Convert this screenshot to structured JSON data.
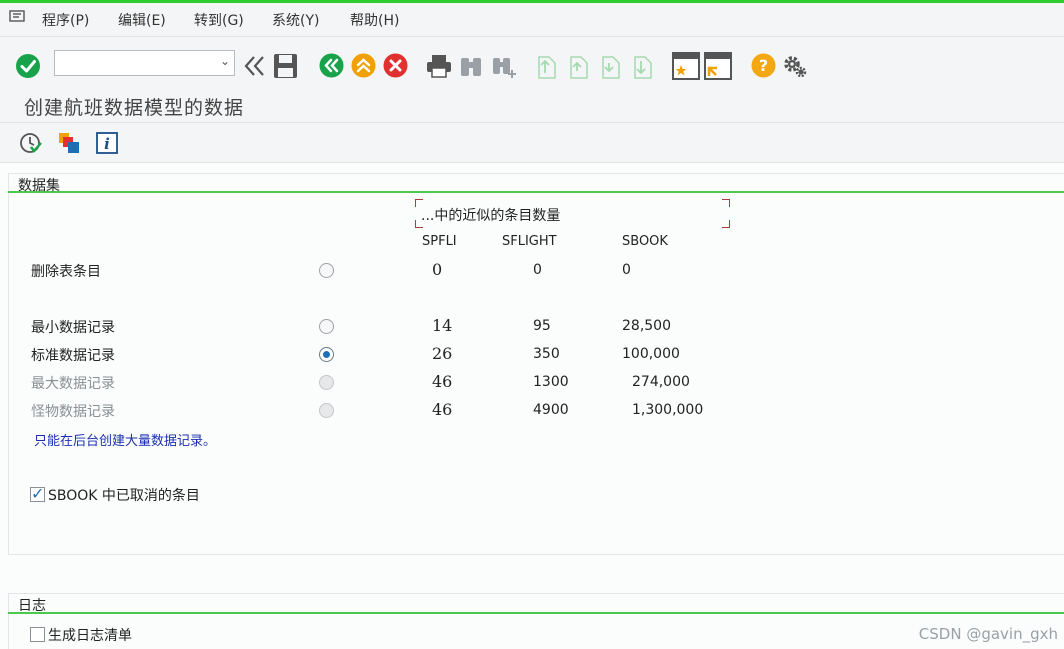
{
  "menubar": {
    "items": [
      "程序(P)",
      "编辑(E)",
      "转到(G)",
      "系统(Y)",
      "帮助(H)"
    ]
  },
  "toolbar": {
    "command_value": "",
    "icons": [
      "enter-icon",
      "command-field",
      "back-double-icon",
      "save-icon",
      "back-icon",
      "exit-icon",
      "cancel-icon",
      "print-icon",
      "find-icon",
      "find-next-icon",
      "first-page-icon",
      "prev-page-icon",
      "next-page-icon",
      "last-page-icon",
      "new-session-icon",
      "shortcut-icon",
      "help-icon",
      "settings-icon"
    ]
  },
  "title": "创建航班数据模型的数据",
  "app_toolbar": {
    "icons": [
      "execute-icon",
      "variants-icon",
      "info-icon"
    ]
  },
  "dataset_group": {
    "title": "数据集",
    "header_note": "...中的近似的条目数量",
    "columns": [
      "SPFLI",
      "SFLIGHT",
      "SBOOK"
    ],
    "rows": [
      {
        "label": "删除表条目",
        "selected": false,
        "disabled": false,
        "values": [
          "0",
          "0",
          "0"
        ]
      },
      {
        "label": "最小数据记录",
        "selected": false,
        "disabled": false,
        "values": [
          "14",
          "95",
          "28,500"
        ]
      },
      {
        "label": "标准数据记录",
        "selected": true,
        "disabled": false,
        "values": [
          "26",
          "350",
          "100,000"
        ]
      },
      {
        "label": "最大数据记录",
        "selected": false,
        "disabled": true,
        "values": [
          "46",
          "1300",
          "274,000"
        ]
      },
      {
        "label": "怪物数据记录",
        "selected": false,
        "disabled": true,
        "values": [
          "46",
          "4900",
          "1,300,000"
        ]
      }
    ],
    "note": "只能在后台创建大量数据记录。",
    "checkbox": {
      "label": "SBOOK 中已取消的条目",
      "checked": true
    }
  },
  "log_group": {
    "title": "日志",
    "checkbox": {
      "label": "生成日志清单",
      "checked": false
    }
  },
  "watermark": "CSDN @gavin_gxh",
  "colors": {
    "accent_green": "#2ecc2e",
    "check_green": "#18a34a",
    "exit_orange": "#f0a000",
    "cancel_red": "#e03030",
    "help_orange": "#f3a712",
    "note_blue": "#1a2fb0"
  }
}
